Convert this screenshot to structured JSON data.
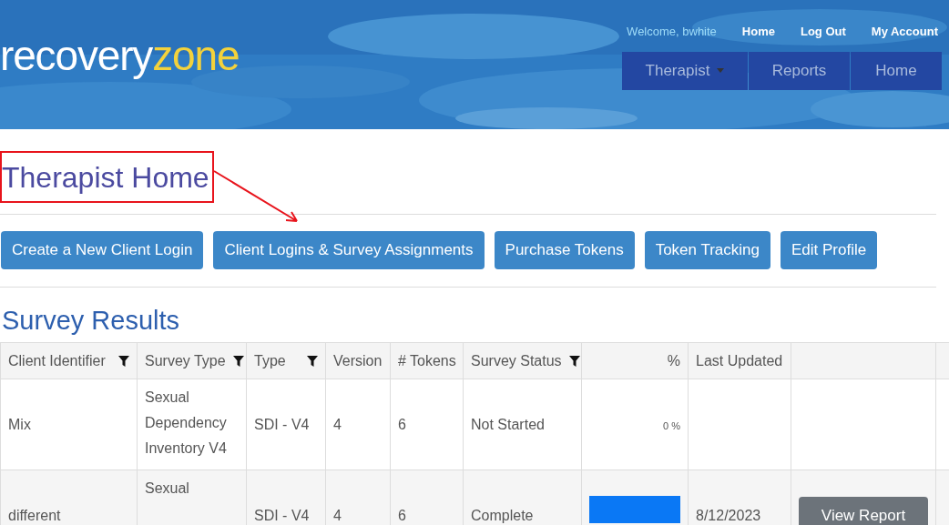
{
  "header": {
    "logo": {
      "part_1": "recovery",
      "part_2": "zone"
    },
    "top_links": [
      {
        "label": "Welcome, bwhite",
        "kind": "greeting"
      },
      {
        "label": "Home",
        "kind": "link"
      },
      {
        "label": "Log Out",
        "kind": "link"
      },
      {
        "label": "My Account",
        "kind": "link"
      }
    ],
    "nav": [
      {
        "label": "Therapist",
        "dropdown": true
      },
      {
        "label": "Reports",
        "dropdown": false
      },
      {
        "label": "Home",
        "dropdown": false
      }
    ]
  },
  "page_title": "Therapist Home",
  "actions": [
    "Create a New Client Login",
    "Client Logins & Survey Assignments",
    "Purchase Tokens",
    "Token Tracking",
    "Edit Profile"
  ],
  "section_title": "Survey Results",
  "table": {
    "columns": [
      {
        "label": "Client Identifier",
        "filter": true
      },
      {
        "label": "Survey Type",
        "filter": true
      },
      {
        "label": "Type",
        "filter": true
      },
      {
        "label": "Version",
        "filter": false
      },
      {
        "label": "# Tokens",
        "filter": false
      },
      {
        "label": "Survey Status",
        "filter": true
      },
      {
        "label": "%",
        "filter": false
      },
      {
        "label": "Last Updated",
        "filter": false
      }
    ],
    "rows": [
      {
        "cells": [
          "Mix",
          "Sexual Dependency Inventory V4",
          "SDI - V4",
          "4",
          "6",
          "Not Started"
        ],
        "percent": "0 %"
      },
      {
        "cells": [
          "different",
          "Sexual",
          "SDI - V4",
          "4",
          "6",
          "Complete"
        ],
        "progress_bar": true,
        "last_updated": "8/12/2023",
        "action": "View Report"
      }
    ]
  }
}
